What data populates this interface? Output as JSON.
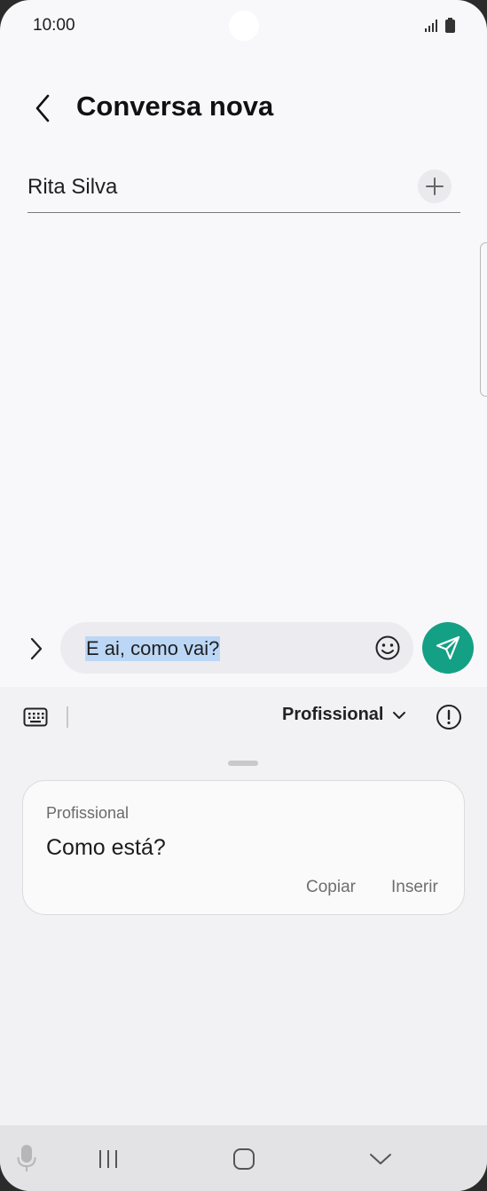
{
  "status_bar": {
    "time": "10:00"
  },
  "header": {
    "title": "Conversa nova"
  },
  "recipient": {
    "name": "Rita Silva"
  },
  "composer": {
    "message": "E ai, como vai?"
  },
  "writing_assist": {
    "tone_selected": "Profissional",
    "suggestion": {
      "tone": "Profissional",
      "text": "Como está?",
      "copy_label": "Copiar",
      "insert_label": "Inserir"
    }
  },
  "colors": {
    "send_button": "#14a084",
    "selection": "#bcd7f6",
    "background": "#f8f8fa"
  }
}
